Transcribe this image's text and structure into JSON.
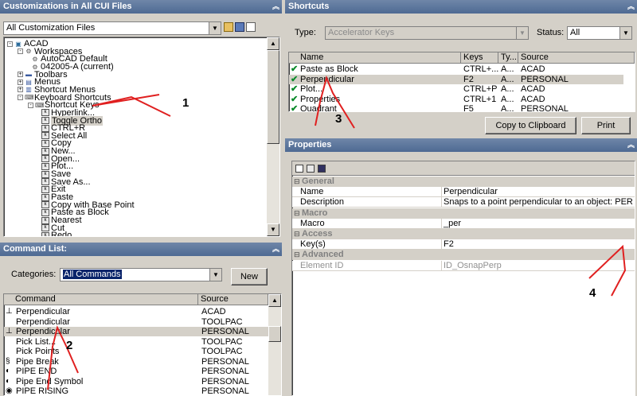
{
  "cui_panel": {
    "title": "Customizations in All CUI Files",
    "filter_value": "All Customization Files",
    "tree": [
      {
        "label": "ACAD",
        "indent": 0,
        "exp": "-",
        "icon": "cui-file-icon"
      },
      {
        "label": "Workspaces",
        "indent": 1,
        "exp": "-",
        "icon": "workspace-icon"
      },
      {
        "label": "AutoCAD Default",
        "indent": 2,
        "exp": "",
        "icon": "workspace-item-icon"
      },
      {
        "label": "042005-A (current)",
        "indent": 2,
        "exp": "",
        "icon": "workspace-item-icon"
      },
      {
        "label": "Toolbars",
        "indent": 1,
        "exp": "+",
        "icon": "toolbar-icon"
      },
      {
        "label": "Menus",
        "indent": 1,
        "exp": "+",
        "icon": "menu-icon"
      },
      {
        "label": "Shortcut Menus",
        "indent": 1,
        "exp": "+",
        "icon": "shortcut-menu-icon"
      },
      {
        "label": "Keyboard Shortcuts",
        "indent": 1,
        "exp": "-",
        "icon": "keyboard-icon"
      },
      {
        "label": "Shortcut Keys",
        "indent": 2,
        "exp": "-",
        "icon": "keyboard-icon"
      },
      {
        "label": "Hyperlink...",
        "indent": 3,
        "exp": "",
        "icon": "key-icon"
      },
      {
        "label": "Toggle Ortho",
        "indent": 3,
        "exp": "",
        "icon": "key-icon",
        "selected": true
      },
      {
        "label": "CTRL+R",
        "indent": 3,
        "exp": "",
        "icon": "key-icon"
      },
      {
        "label": "Select All",
        "indent": 3,
        "exp": "",
        "icon": "key-icon"
      },
      {
        "label": "Copy",
        "indent": 3,
        "exp": "",
        "icon": "key-icon"
      },
      {
        "label": "New...",
        "indent": 3,
        "exp": "",
        "icon": "key-icon"
      },
      {
        "label": "Open...",
        "indent": 3,
        "exp": "",
        "icon": "key-icon"
      },
      {
        "label": "Plot...",
        "indent": 3,
        "exp": "",
        "icon": "key-icon"
      },
      {
        "label": "Save",
        "indent": 3,
        "exp": "",
        "icon": "key-icon"
      },
      {
        "label": "Save As...",
        "indent": 3,
        "exp": "",
        "icon": "key-icon"
      },
      {
        "label": "Exit",
        "indent": 3,
        "exp": "",
        "icon": "key-icon"
      },
      {
        "label": "Paste",
        "indent": 3,
        "exp": "",
        "icon": "key-icon"
      },
      {
        "label": "Copy with Base Point",
        "indent": 3,
        "exp": "",
        "icon": "key-icon"
      },
      {
        "label": "Paste as Block",
        "indent": 3,
        "exp": "",
        "icon": "key-icon"
      },
      {
        "label": "Nearest",
        "indent": 3,
        "exp": "",
        "icon": "key-icon"
      },
      {
        "label": "Cut",
        "indent": 3,
        "exp": "",
        "icon": "key-icon"
      },
      {
        "label": "Redo",
        "indent": 3,
        "exp": "",
        "icon": "key-icon"
      }
    ]
  },
  "command_panel": {
    "title": "Command List:",
    "categories_label": "Categories:",
    "categories_value": "All Commands",
    "new_button": "New",
    "headers": [
      "Command",
      "Source"
    ],
    "rows": [
      {
        "command": "Perpendicular",
        "source": "ACAD",
        "icon": "perpendicular-icon"
      },
      {
        "command": "Perpendicular",
        "source": "TOOLPAC",
        "icon": ""
      },
      {
        "command": "Perpendicular",
        "source": "PERSONAL",
        "icon": "perpendicular-icon",
        "selected": true
      },
      {
        "command": "Pick List...",
        "source": "TOOLPAC",
        "icon": ""
      },
      {
        "command": "Pick Points",
        "source": "TOOLPAC",
        "icon": ""
      },
      {
        "command": "Pipe Break",
        "source": "PERSONAL",
        "icon": "pipe-break-icon"
      },
      {
        "command": "PIPE END",
        "source": "PERSONAL",
        "icon": "pipe-end-icon"
      },
      {
        "command": "Pipe End Symbol",
        "source": "PERSONAL",
        "icon": "pipe-end-icon"
      },
      {
        "command": "PIPE RISING",
        "source": "PERSONAL",
        "icon": "pipe-rising-icon"
      }
    ]
  },
  "shortcuts_panel": {
    "title": "Shortcuts",
    "type_label": "Type:",
    "type_value": "Accelerator Keys",
    "status_label": "Status:",
    "status_value": "All",
    "headers": [
      "Name",
      "Keys",
      "Ty...",
      "Source"
    ],
    "rows": [
      {
        "name": "Paste as Block",
        "keys": "CTRL+...",
        "type": "A...",
        "source": "ACAD"
      },
      {
        "name": "Perpendicular",
        "keys": "F2",
        "type": "A...",
        "source": "PERSONAL",
        "selected": true
      },
      {
        "name": "Plot...",
        "keys": "CTRL+P",
        "type": "A...",
        "source": "ACAD"
      },
      {
        "name": "Properties",
        "keys": "CTRL+1",
        "type": "A...",
        "source": "ACAD"
      },
      {
        "name": "Quadrant",
        "keys": "F5",
        "type": "A...",
        "source": "PERSONAL"
      }
    ],
    "copy_button": "Copy to Clipboard",
    "print_button": "Print"
  },
  "properties_panel": {
    "title": "Properties",
    "rows": [
      {
        "kind": "cat",
        "label": "General"
      },
      {
        "kind": "row",
        "label": "Name",
        "value": "Perpendicular"
      },
      {
        "kind": "row",
        "label": "Description",
        "value": "Snaps to a point perpendicular to an object:  PER"
      },
      {
        "kind": "cat",
        "label": "Macro"
      },
      {
        "kind": "row",
        "label": "Macro",
        "value": "_per"
      },
      {
        "kind": "cat",
        "label": "Access"
      },
      {
        "kind": "row",
        "label": "Key(s)",
        "value": "F2"
      },
      {
        "kind": "cat",
        "label": "Advanced"
      },
      {
        "kind": "row",
        "label": "Element ID",
        "value": "ID_OsnapPerp",
        "disabled": true
      }
    ]
  },
  "annotations": [
    "1",
    "2",
    "3",
    "4"
  ]
}
